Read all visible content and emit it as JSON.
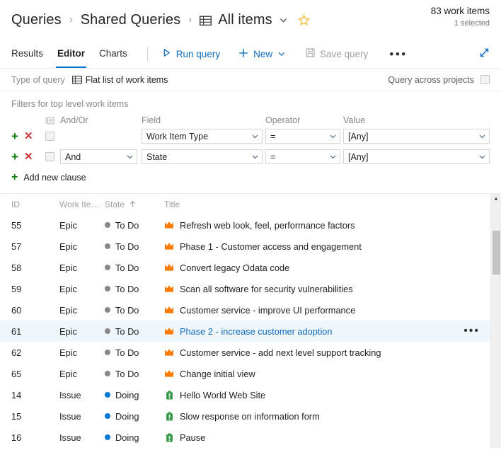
{
  "header": {
    "breadcrumb": [
      {
        "label": "Queries",
        "icon": null
      },
      {
        "label": "Shared Queries",
        "icon": null
      },
      {
        "label": "All items",
        "icon": "grid-icon"
      }
    ],
    "separator": "›",
    "chevron": "⌄",
    "favorite_icon": "star-icon",
    "work_items_count": "83 work items",
    "selected_count": "1 selected"
  },
  "toolbar": {
    "tabs": [
      {
        "label": "Results",
        "active": false
      },
      {
        "label": "Editor",
        "active": true
      },
      {
        "label": "Charts",
        "active": false
      }
    ],
    "run_query_label": "Run query",
    "run_query_icon": "play-icon",
    "new_label": "New",
    "new_icon": "plus-icon",
    "new_chevron_icon": "chevron-down-icon",
    "save_query_label": "Save query",
    "save_query_icon": "save-icon",
    "save_query_disabled": true,
    "overflow_label": "•••",
    "expand_icon": "expand-diagonal-icon"
  },
  "query_type": {
    "label": "Type of query",
    "value": "Flat list of work items",
    "value_icon": "grid-icon",
    "across_projects_label": "Query across projects",
    "across_projects_checked": false
  },
  "filters": {
    "title": "Filters for top level work items",
    "group_icon": "list-group-icon",
    "columns": {
      "andor": "And/Or",
      "field": "Field",
      "operator": "Operator",
      "value": "Value"
    },
    "add_icon": "plus-icon",
    "delete_icon": "close-icon",
    "chevron_icon": "chevron-down-icon",
    "rows": [
      {
        "andor": "",
        "field": "Work Item Type",
        "operator": "=",
        "value": "[Any]",
        "checked": false
      },
      {
        "andor": "And",
        "field": "State",
        "operator": "=",
        "value": "[Any]",
        "checked": false
      }
    ],
    "add_clause_label": "Add new clause"
  },
  "results": {
    "columns": [
      {
        "key": "id",
        "label": "ID"
      },
      {
        "key": "type",
        "label": "Work Item..."
      },
      {
        "key": "state",
        "label": "State",
        "sort": "asc",
        "sort_icon": "arrow-up-icon"
      },
      {
        "key": "title",
        "label": "Title"
      }
    ],
    "state_colors": {
      "To Do": "#8a8886",
      "Doing": "#0078d4"
    },
    "type_icons": {
      "Epic": {
        "name": "crown-icon",
        "color": "#ff7b00"
      },
      "Issue": {
        "name": "issue-icon",
        "color": "#339947"
      }
    },
    "row_more_label": "•••",
    "rows": [
      {
        "id": "55",
        "type": "Epic",
        "state": "To Do",
        "title": "Refresh web look, feel, performance factors",
        "selected": false
      },
      {
        "id": "57",
        "type": "Epic",
        "state": "To Do",
        "title": "Phase 1 - Customer access and engagement",
        "selected": false
      },
      {
        "id": "58",
        "type": "Epic",
        "state": "To Do",
        "title": "Convert legacy Odata code",
        "selected": false
      },
      {
        "id": "59",
        "type": "Epic",
        "state": "To Do",
        "title": "Scan all software for security vulnerabilities",
        "selected": false
      },
      {
        "id": "60",
        "type": "Epic",
        "state": "To Do",
        "title": "Customer service - improve UI performance",
        "selected": false
      },
      {
        "id": "61",
        "type": "Epic",
        "state": "To Do",
        "title": "Phase 2 - increase customer adoption",
        "selected": true
      },
      {
        "id": "62",
        "type": "Epic",
        "state": "To Do",
        "title": "Customer service - add next level support tracking",
        "selected": false
      },
      {
        "id": "65",
        "type": "Epic",
        "state": "To Do",
        "title": "Change initial view",
        "selected": false
      },
      {
        "id": "14",
        "type": "Issue",
        "state": "Doing",
        "title": "Hello World Web Site",
        "selected": false
      },
      {
        "id": "15",
        "type": "Issue",
        "state": "Doing",
        "title": "Slow response on information form",
        "selected": false
      },
      {
        "id": "16",
        "type": "Issue",
        "state": "Doing",
        "title": "Pause",
        "selected": false
      }
    ],
    "scrollbar": {
      "arrow_up_icon": "caret-up-icon"
    }
  },
  "colors": {
    "accent": "#0078d4",
    "link": "#0f6cbd",
    "add": "#107c10",
    "delete": "#d13438",
    "selected_row": "#eff6fc",
    "star": "#ffb900"
  }
}
